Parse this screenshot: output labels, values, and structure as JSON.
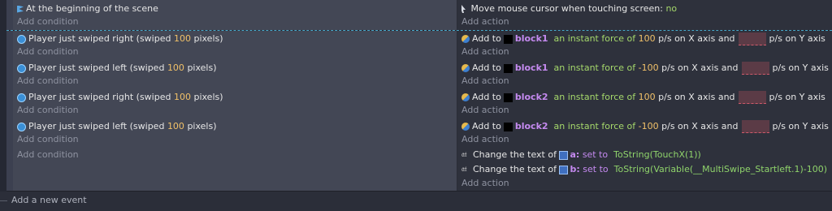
{
  "common": {
    "add_condition": "Add condition",
    "add_action": "Add action",
    "add_to": "Add to",
    "instant_force": "an instant force of",
    "on_x_and": "p/s on X axis and",
    "on_y": "p/s on Y axis",
    "change_text_of": "Change the text of",
    "set_to": "set to"
  },
  "events": [
    {
      "condition": "At the beginning of the scene",
      "action_text": "Move mouse cursor when touching screen:",
      "action_value": "no"
    },
    {
      "cond_pre": "Player just swiped right (swiped",
      "cond_num": "100",
      "cond_post": "pixels)",
      "object": "block1",
      "force": "100"
    },
    {
      "cond_pre": "Player just swiped left (swiped",
      "cond_num": "100",
      "cond_post": "pixels)",
      "object": "block1",
      "force": "-100"
    },
    {
      "cond_pre": "Player just swiped right (swiped",
      "cond_num": "100",
      "cond_post": "pixels)",
      "object": "block2",
      "force": "100"
    },
    {
      "cond_pre": "Player just swiped left (swiped",
      "cond_num": "100",
      "cond_post": "pixels)",
      "object": "block2",
      "force": "-100"
    },
    {
      "text_actions": [
        {
          "object": "a:",
          "expr": "ToString(TouchX(1))"
        },
        {
          "object": "b:",
          "expr": "ToString(Variable(__MultiSwipe_Startleft.1)-100)"
        }
      ]
    }
  ],
  "footer": {
    "add_event": "Add a new event"
  },
  "colors": {
    "selected_border": "#47a7c9",
    "number": "#f0c069",
    "object": "#c58af0",
    "keyword": "#a5d86b"
  }
}
